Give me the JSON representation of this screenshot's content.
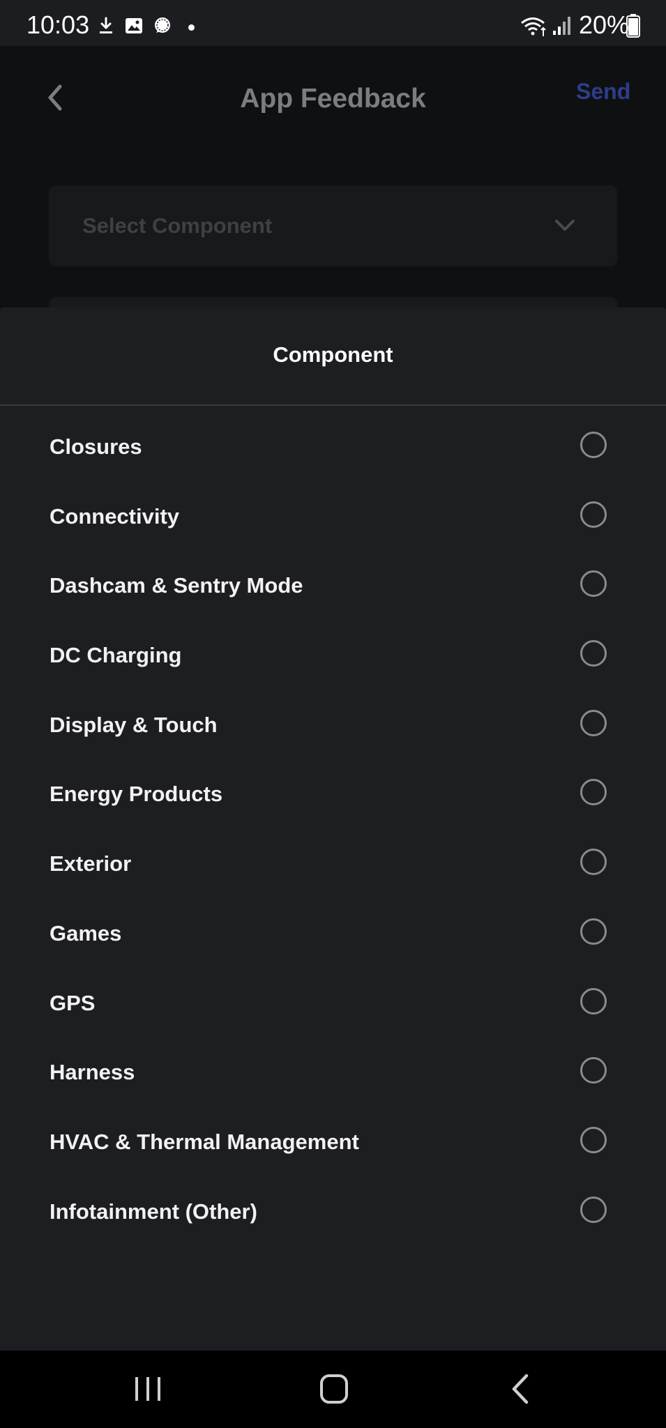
{
  "status_bar": {
    "time": "10:03",
    "battery": "20%",
    "icons": [
      "download-icon",
      "image-icon",
      "chat-bubble-icon",
      "dot-icon",
      "wifi-icon",
      "signal-icon",
      "battery-icon"
    ]
  },
  "header": {
    "back_icon": "chevron-left-icon",
    "title": "App Feedback",
    "send_label": "Send"
  },
  "form": {
    "select_placeholder": "Select Component",
    "select_icon": "chevron-down-icon"
  },
  "sheet": {
    "title": "Component",
    "options": [
      {
        "label": "Closures",
        "selected": false
      },
      {
        "label": "Connectivity",
        "selected": false
      },
      {
        "label": "Dashcam & Sentry Mode",
        "selected": false
      },
      {
        "label": "DC Charging",
        "selected": false
      },
      {
        "label": "Display & Touch",
        "selected": false
      },
      {
        "label": "Energy Products",
        "selected": false
      },
      {
        "label": "Exterior",
        "selected": false
      },
      {
        "label": "Games",
        "selected": false
      },
      {
        "label": "GPS",
        "selected": false
      },
      {
        "label": "Harness",
        "selected": false
      },
      {
        "label": "HVAC & Thermal Management",
        "selected": false
      },
      {
        "label": "Infotainment (Other)",
        "selected": false
      }
    ]
  },
  "nav_bar": {
    "icons": [
      "recent-apps-icon",
      "home-icon",
      "back-icon"
    ]
  },
  "colors": {
    "accent_send": "#2d3d8c",
    "sheet_bg": "#1d1e21",
    "radio_border": "#8a8b8f"
  }
}
